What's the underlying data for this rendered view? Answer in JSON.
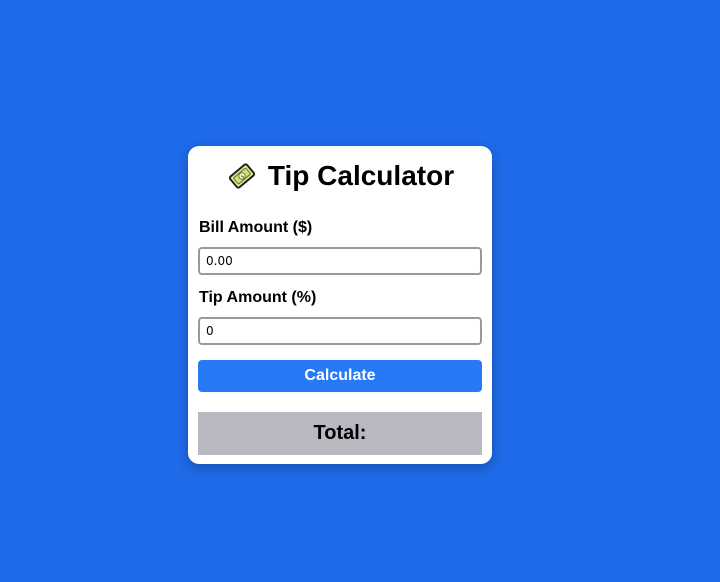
{
  "colors": {
    "background": "#1f6bea",
    "card": "#ffffff",
    "button": "#2779f6",
    "total_bg": "#b9b7c0"
  },
  "card": {
    "title": "Tip Calculator",
    "title_icon": "money-bill-icon",
    "bill": {
      "label": "Bill Amount ($)",
      "value": "0.00"
    },
    "tip": {
      "label": "Tip Amount (%)",
      "value": "0"
    },
    "calculate_label": "Calculate",
    "total_label": "Total:"
  }
}
